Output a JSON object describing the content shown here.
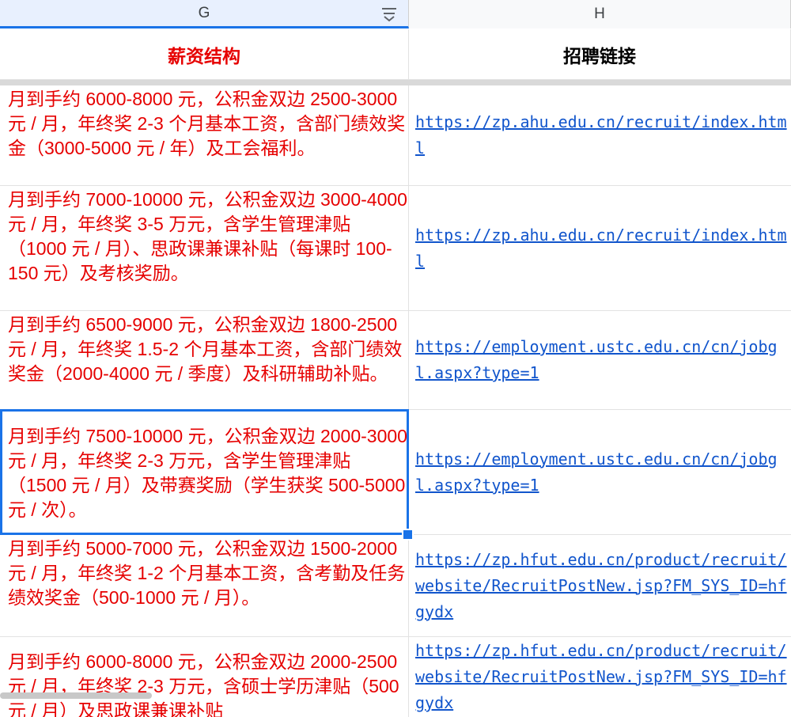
{
  "columns": {
    "g_letter": "G",
    "h_letter": "H"
  },
  "header": {
    "salary": "薪资结构",
    "link": "招聘链接"
  },
  "rows": [
    {
      "salary": "月到手约 6000-8000 元，公积金双边 2500-3000 元 / 月，年终奖 2-3 个月基本工资，含部门绩效奖金（3000-5000 元 / 年）及工会福利。",
      "link": "https://zp.ahu.edu.cn/recruit/index.html"
    },
    {
      "salary": "月到手约 7000-10000 元，公积金双边 3000-4000 元 / 月，年终奖 3-5 万元，含学生管理津贴（1000 元 / 月）、思政课兼课补贴（每课时 100-150 元）及考核奖励。",
      "link": "https://zp.ahu.edu.cn/recruit/index.html"
    },
    {
      "salary": "月到手约 6500-9000 元，公积金双边 1800-2500 元 / 月，年终奖 1.5-2 个月基本工资，含部门绩效奖金（2000-4000 元 / 季度）及科研辅助补贴。",
      "link": "https://employment.ustc.edu.cn/cn/jobgl.aspx?type=1"
    },
    {
      "salary": "月到手约 7500-10000 元，公积金双边 2000-3000 元 / 月，年终奖 2-3 万元，含学生管理津贴（1500 元 / 月）及带赛奖励（学生获奖 500-5000 元 / 次）。",
      "link": "https://employment.ustc.edu.cn/cn/jobgl.aspx?type=1"
    },
    {
      "salary": "月到手约 5000-7000 元，公积金双边 1500-2000 元 / 月，年终奖 1-2 个月基本工资，含考勤及任务绩效奖金（500-1000 元 / 月）。",
      "link": "https://zp.hfut.edu.cn/product/recruit/website/RecruitPostNew.jsp?FM_SYS_ID=hfgydx"
    },
    {
      "salary": "月到手约 6000-8000 元，公积金双边 2000-2500 元 / 月，年终奖 2-3 万元，含硕士学历津贴（500 元 / 月）及思政课兼课补贴",
      "link": "https://zp.hfut.edu.cn/product/recruit/website/RecruitPostNew.jsp?FM_SYS_ID=hfgydx"
    }
  ],
  "colors": {
    "accent": "#1a73e8",
    "salary_text": "#e60000",
    "link": "#1155cc"
  },
  "icons": {
    "filter": "filter-icon"
  }
}
